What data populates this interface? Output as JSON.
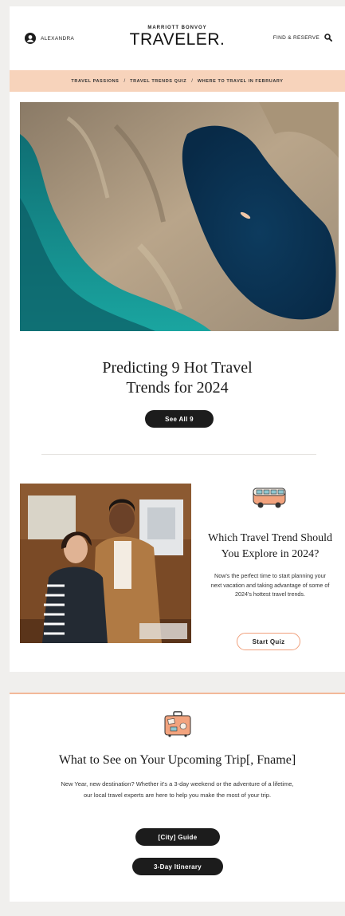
{
  "header": {
    "user_name": "ALEXANDRA",
    "brand_sup": "MARRIOTT BONVOY",
    "brand_main": "TRAVELER.",
    "find_label": "FIND & RESERVE"
  },
  "breadcrumbs": [
    "TRAVEL PASSIONS",
    "TRAVEL TRENDS QUIZ",
    "WHERE TO TRAVEL IN FEBRUARY"
  ],
  "breadcrumb_separator": "/",
  "hero": {
    "title_line1": "Predicting 9 Hot Travel",
    "title_line2": "Trends for 2024",
    "button_label": "See All 9"
  },
  "quiz": {
    "title_line1": "Which Travel Trend Should",
    "title_line2": "You Explore in 2024?",
    "body": "Now's the perfect time to start planning your next vacation and taking advantage of some of 2024's hottest travel trends.",
    "button_label": "Start Quiz"
  },
  "trip": {
    "title": "What to See on Your Upcoming Trip[, Fname]",
    "body": "New Year, new destination? Whether it's a 3-day weekend or the adventure of a lifetime, our local travel experts are here to help you make the most of your trip.",
    "button1_label": "[City] Guide",
    "button2_label": "3-Day Itinerary"
  },
  "colors": {
    "accent_peach": "#f7d3bb",
    "accent_orange": "#f0a07c",
    "dark_button": "#1c1c1c"
  },
  "icons": [
    "user-icon",
    "search-icon",
    "van-icon",
    "suitcase-icon"
  ]
}
